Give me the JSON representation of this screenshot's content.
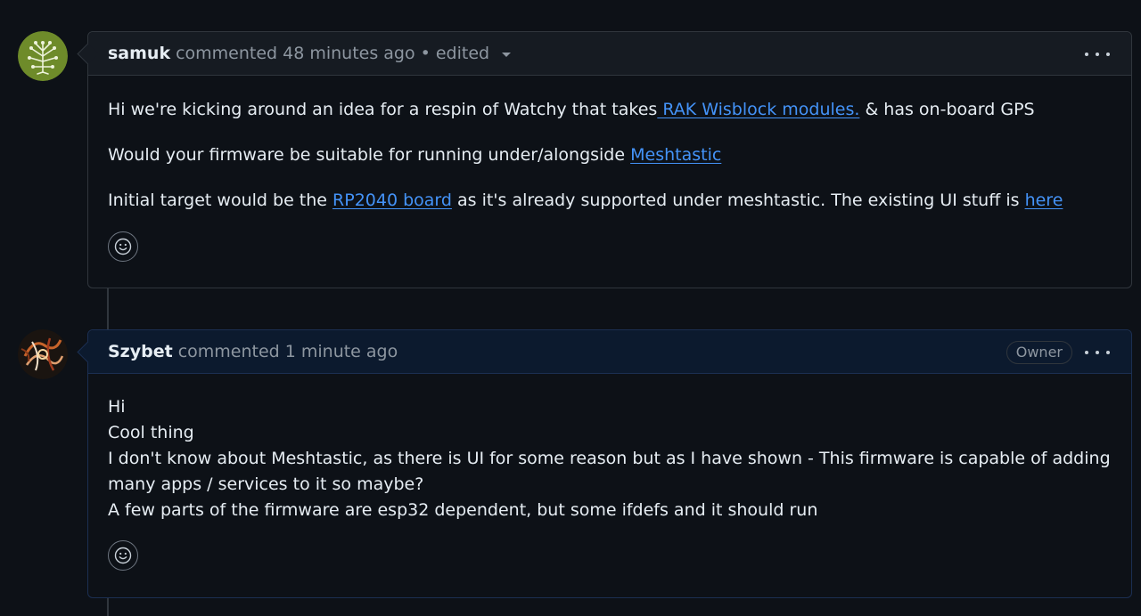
{
  "comments": [
    {
      "author": "samuk",
      "action": "commented",
      "time": "48 minutes ago",
      "edited": "• edited",
      "avatar_icon": "tree-circuit-icon",
      "body": {
        "p1_before": "Hi we're kicking around an idea for a respin of Watchy that takes",
        "p1_link": " RAK Wisblock modules.",
        "p1_after": " & has on-board GPS",
        "p2_before": "Would your firmware be suitable for running under/alongside ",
        "p2_link": "Meshtastic",
        "p3_before": "Initial target would be the ",
        "p3_link": "RP2040 board",
        "p3_middle": " as it's already supported under meshtastic. The existing UI stuff is ",
        "p3_link2": "here"
      }
    },
    {
      "author": "Szybet",
      "action": "commented",
      "time": "1 minute ago",
      "badge": "Owner",
      "avatar_icon": "abstract-art-avatar",
      "body": {
        "line1": "Hi",
        "line2": "Cool thing",
        "line3": "I don't know about Meshtastic, as there is UI for some reason but as I have shown - This firmware is capable of adding",
        "line4": "many apps / services to it so maybe?",
        "line5": "A few parts of the firmware are esp32 dependent, but some ifdefs and it should run"
      }
    }
  ],
  "colors": {
    "background": "#0d1117",
    "link": "#4493f8",
    "muted": "#8d96a0",
    "border": "#30363d",
    "owner_border": "#1b2f52"
  }
}
